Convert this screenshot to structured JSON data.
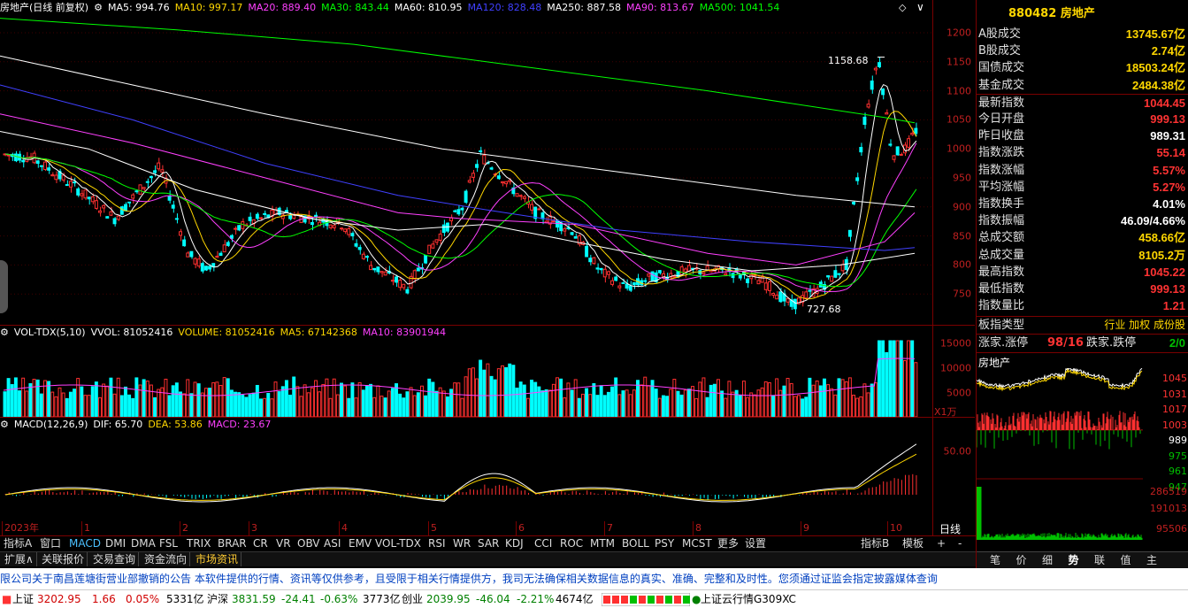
{
  "title": {
    "name": "房地产(日线 前复权)",
    "ma": [
      {
        "label": "MA5: 994.76",
        "color": "#ffffff"
      },
      {
        "label": "MA10: 997.17",
        "color": "#ffd700"
      },
      {
        "label": "MA20: 889.40",
        "color": "#ff40ff"
      },
      {
        "label": "MA30: 843.44",
        "color": "#00ff00"
      },
      {
        "label": "MA60: 810.95",
        "color": "#ffffff"
      },
      {
        "label": "MA120: 828.48",
        "color": "#4040ff"
      },
      {
        "label": "MA250: 887.58",
        "color": "#ffffff"
      },
      {
        "label": "MA90: 813.67",
        "color": "#ff40ff"
      },
      {
        "label": "MA500: 1041.54",
        "color": "#00ff00"
      }
    ]
  },
  "price_axis": [
    "1200",
    "1150",
    "1100",
    "1050",
    "1000",
    "950",
    "900",
    "850",
    "800",
    "750"
  ],
  "annotations": {
    "high": "1158.68",
    "low": "727.68"
  },
  "vol_title": {
    "name": "VOL-TDX(5,10)",
    "vvol": "VVOL: 81052416",
    "volume": "VOLUME: 81052416",
    "ma5": "MA5: 67142368",
    "ma10": "MA10: 83901944"
  },
  "vol_axis": [
    "15000",
    "10000",
    "5000"
  ],
  "vol_unit": "X1万",
  "macd_title": {
    "name": "MACD(12,26,9)",
    "dif": "DIF: 65.70",
    "dea": "DEA: 53.86",
    "macd": "MACD: 23.67"
  },
  "macd_axis": [
    "50.00"
  ],
  "period": "日线",
  "months": [
    "2023年",
    "1",
    "2",
    "3",
    "4",
    "5",
    "6",
    "7",
    "8",
    "9",
    "10"
  ],
  "tabs": [
    "指标A",
    "窗口",
    "MACD",
    "DMI",
    "DMA",
    "FSL",
    "TRIX",
    "BRAR",
    "CR",
    "VR",
    "OBV",
    "ASI",
    "EMV",
    "VOL-TDX",
    "RSI",
    "WR",
    "SAR",
    "KDJ",
    "CCI",
    "ROC",
    "MTM",
    "BOLL",
    "PSY",
    "MCST",
    "更多",
    "设置"
  ],
  "tabs_right": [
    "指标B",
    "模板",
    "+",
    "-"
  ],
  "subtabs": [
    "扩展∧",
    "关联报价",
    "交易查询",
    "资金流向",
    "市场资讯"
  ],
  "panel": {
    "code": "880482",
    "name": "房地产",
    "rows": [
      {
        "label": "A股成交",
        "value": "13745.67亿",
        "color": "#ffd700"
      },
      {
        "label": "B股成交",
        "value": "2.74亿",
        "color": "#ffd700"
      },
      {
        "label": "国债成交",
        "value": "18503.24亿",
        "color": "#ffd700"
      },
      {
        "label": "基金成交",
        "value": "2484.38亿",
        "color": "#ffd700"
      },
      {
        "label": "最新指数",
        "value": "1044.45",
        "color": "#ff3333"
      },
      {
        "label": "今日开盘",
        "value": "999.13",
        "color": "#ff3333"
      },
      {
        "label": "昨日收盘",
        "value": "989.31",
        "color": "#ffffff"
      },
      {
        "label": "指数涨跌",
        "value": "55.14",
        "color": "#ff3333"
      },
      {
        "label": "指数涨幅",
        "value": "5.57%",
        "color": "#ff3333"
      },
      {
        "label": "平均涨幅",
        "value": "5.27%",
        "color": "#ff3333"
      },
      {
        "label": "指数换手",
        "value": "4.01%",
        "color": "#ffffff"
      },
      {
        "label": "指数振幅",
        "value": "46.09/4.66%",
        "color": "#ffffff"
      },
      {
        "label": "总成交额",
        "value": "458.66亿",
        "color": "#ffd700"
      },
      {
        "label": "总成交量",
        "value": "8105.2万",
        "color": "#ffd700"
      },
      {
        "label": "最高指数",
        "value": "1045.22",
        "color": "#ff3333"
      },
      {
        "label": "最低指数",
        "value": "999.13",
        "color": "#ff3333"
      },
      {
        "label": "指数量比",
        "value": "1.21",
        "color": "#ff3333"
      }
    ],
    "type_label": "板指类型",
    "type_value": "行业 加权 成份股",
    "updown_label1": "涨家.涨停",
    "updown_value1": "98/16",
    "updown_label2": "跌家.跌停",
    "updown_value2": "2/0",
    "mini_title": "房地产",
    "mini_axis": [
      "1045",
      "1031",
      "1017",
      "1003",
      "989",
      "975",
      "961",
      "947",
      "286519",
      "191013",
      "95506"
    ],
    "bottom_tabs": [
      "笔",
      "价",
      "细",
      "势",
      "联",
      "值",
      "主"
    ]
  },
  "news": "限公司关于南昌莲塘街营业部撤销的公告                                    本软件提供的行情、资讯等仅供参考，且受限于相关行情提供方，我司无法确保相关数据信息的真实、准确、完整和及时性。您须通过证监会指定披露媒体查询",
  "status": {
    "sh_label": "上证",
    "sh_val": "3202.95",
    "sh_chg": "1.66",
    "sh_pct": "0.05%",
    "sh_amt": "5331亿",
    "sz_label": "沪深",
    "sz_val": "3831.59",
    "sz_chg": "-24.41",
    "sz_pct": "-0.63%",
    "sz_amt": "3773亿",
    "cy_label": "创业",
    "cy_val": "2039.95",
    "cy_chg": "-46.04",
    "cy_pct": "-2.21%",
    "cy_amt": "4674亿",
    "cloud": "上证云行情G309XC"
  }
}
